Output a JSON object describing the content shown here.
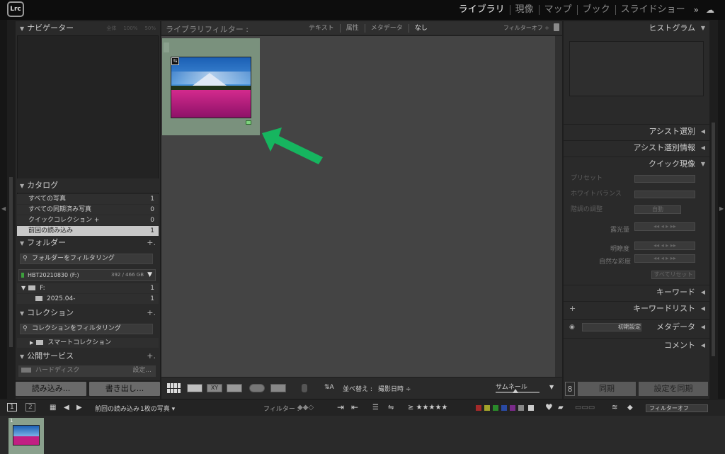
{
  "app": {
    "logo": "Lrc",
    "modules": [
      "ライブラリ",
      "現像",
      "マップ",
      "ブック",
      "スライドショー"
    ],
    "active_module": "ライブラリ",
    "more": "»"
  },
  "left": {
    "navigator": {
      "title": "ナビゲーター",
      "zoom": [
        "全体",
        "100%",
        "50%"
      ]
    },
    "catalog": {
      "title": "カタログ",
      "items": [
        {
          "label": "すべての写真",
          "count": "1"
        },
        {
          "label": "すべての同期済み写真",
          "count": "0"
        },
        {
          "label": "クイックコレクション +",
          "count": "0"
        },
        {
          "label": "前回の読み込み",
          "count": "1"
        }
      ]
    },
    "folders": {
      "title": "フォルダー",
      "filter": "フォルダーをフィルタリング",
      "volume": "HBT20210830 (F:)",
      "volume_size": "392 / 466 GB",
      "tree": [
        {
          "label": "F:",
          "count": "1"
        },
        {
          "label": "2025.04-",
          "count": "1"
        }
      ]
    },
    "collections": {
      "title": "コレクション",
      "filter": "コレクションをフィルタリング",
      "smart": "スマートコレクション"
    },
    "publish": {
      "title": "公開サービス",
      "harddisk": "ハードディスク",
      "setting": "設定..."
    },
    "import_btn": "読み込み...",
    "export_btn": "書き出し..."
  },
  "center": {
    "filter_title": "ライブラリフィルター :",
    "filter_tabs": [
      "テキスト",
      "属性",
      "メタデータ",
      "なし"
    ],
    "filter_active": "なし",
    "filter_off": "フィルターオフ ÷",
    "photo_badge": "⇆",
    "sort_label": "並べ替え :",
    "sort_value": "撮影日時 ÷",
    "thumb_label": "サムネール",
    "arrow_color": "#16b55f"
  },
  "right": {
    "histogram": "ヒストグラム",
    "assist": "アシスト選別",
    "assist_info": "アシスト選別情報",
    "quick_develop": "クイック現像",
    "preset": "プリセット",
    "white_balance": "ホワイトバランス",
    "tone": "階調の調整",
    "auto": "自動",
    "exposure": "露光量",
    "clarity": "明瞭度",
    "vibrance": "自然な彩度",
    "reset": "すべてリセット",
    "keyword": "キーワード",
    "keyword_list": "キーワードリスト",
    "metadata": "メタデータ",
    "metadata_preset": "初期設定",
    "comment": "コメント",
    "sync_btn": "同期",
    "sync_settings_btn": "設定を同期"
  },
  "filmstrip": {
    "page1": "1",
    "page2": "2",
    "source": "前回の読み込み",
    "count": "1枚の写真 ▾",
    "filter_label": "フィルター :",
    "filter_state": "フィルターオフ",
    "frame_number": "1",
    "color_labels": [
      "#a32a2a",
      "#a3a32a",
      "#2a8a2a",
      "#2a4aa3",
      "#7a2a8a",
      "#888888",
      "#cccccc"
    ]
  }
}
